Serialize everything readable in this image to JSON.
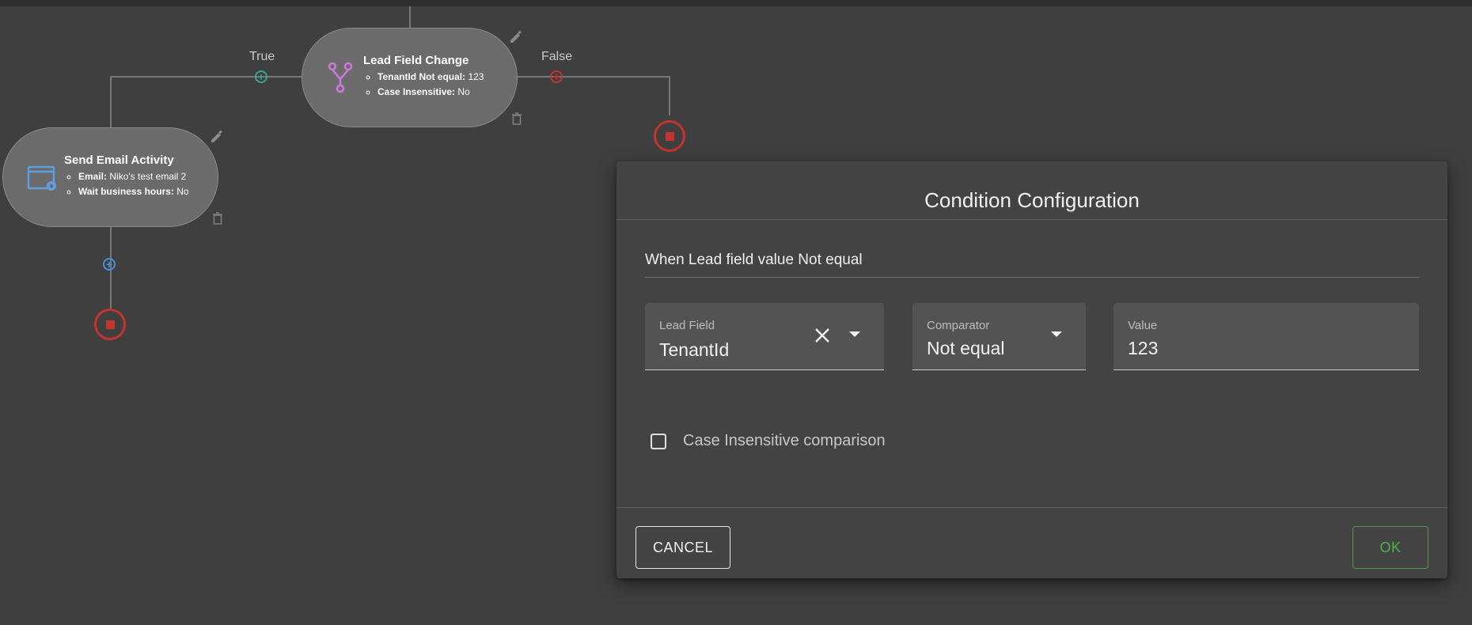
{
  "canvas": {
    "nodes": {
      "lead_field_change": {
        "title": "Lead Field Change",
        "props": [
          {
            "key": "TenantId Not equal:",
            "value": "123"
          },
          {
            "key": "Case Insensitive:",
            "value": "No"
          }
        ],
        "icon": "branch-icon"
      },
      "send_email_activity": {
        "title": "Send Email Activity",
        "props": [
          {
            "key": "Email:",
            "value": "Niko's test email 2"
          },
          {
            "key": "Wait business hours:",
            "value": "No"
          }
        ],
        "icon": "email-settings-icon"
      }
    },
    "branches": {
      "true_label": "True",
      "false_label": "False"
    },
    "colors": {
      "true_plus": "#3aa58f",
      "false_plus": "#c3332f",
      "add_plus": "#4a8fdc",
      "stop": "#c3332f",
      "branch_icon": "#c77ad9",
      "email_icon": "#5f9fe0"
    }
  },
  "dialog": {
    "title": "Condition Configuration",
    "summary": "When Lead field value Not equal",
    "fields": {
      "lead_field": {
        "label": "Lead Field",
        "value": "TenantId"
      },
      "comparator": {
        "label": "Comparator",
        "value": "Not equal"
      },
      "value": {
        "label": "Value",
        "value": "123"
      }
    },
    "case_insensitive": {
      "label": "Case Insensitive comparison",
      "checked": false
    },
    "buttons": {
      "cancel": "CANCEL",
      "ok": "OK"
    }
  }
}
